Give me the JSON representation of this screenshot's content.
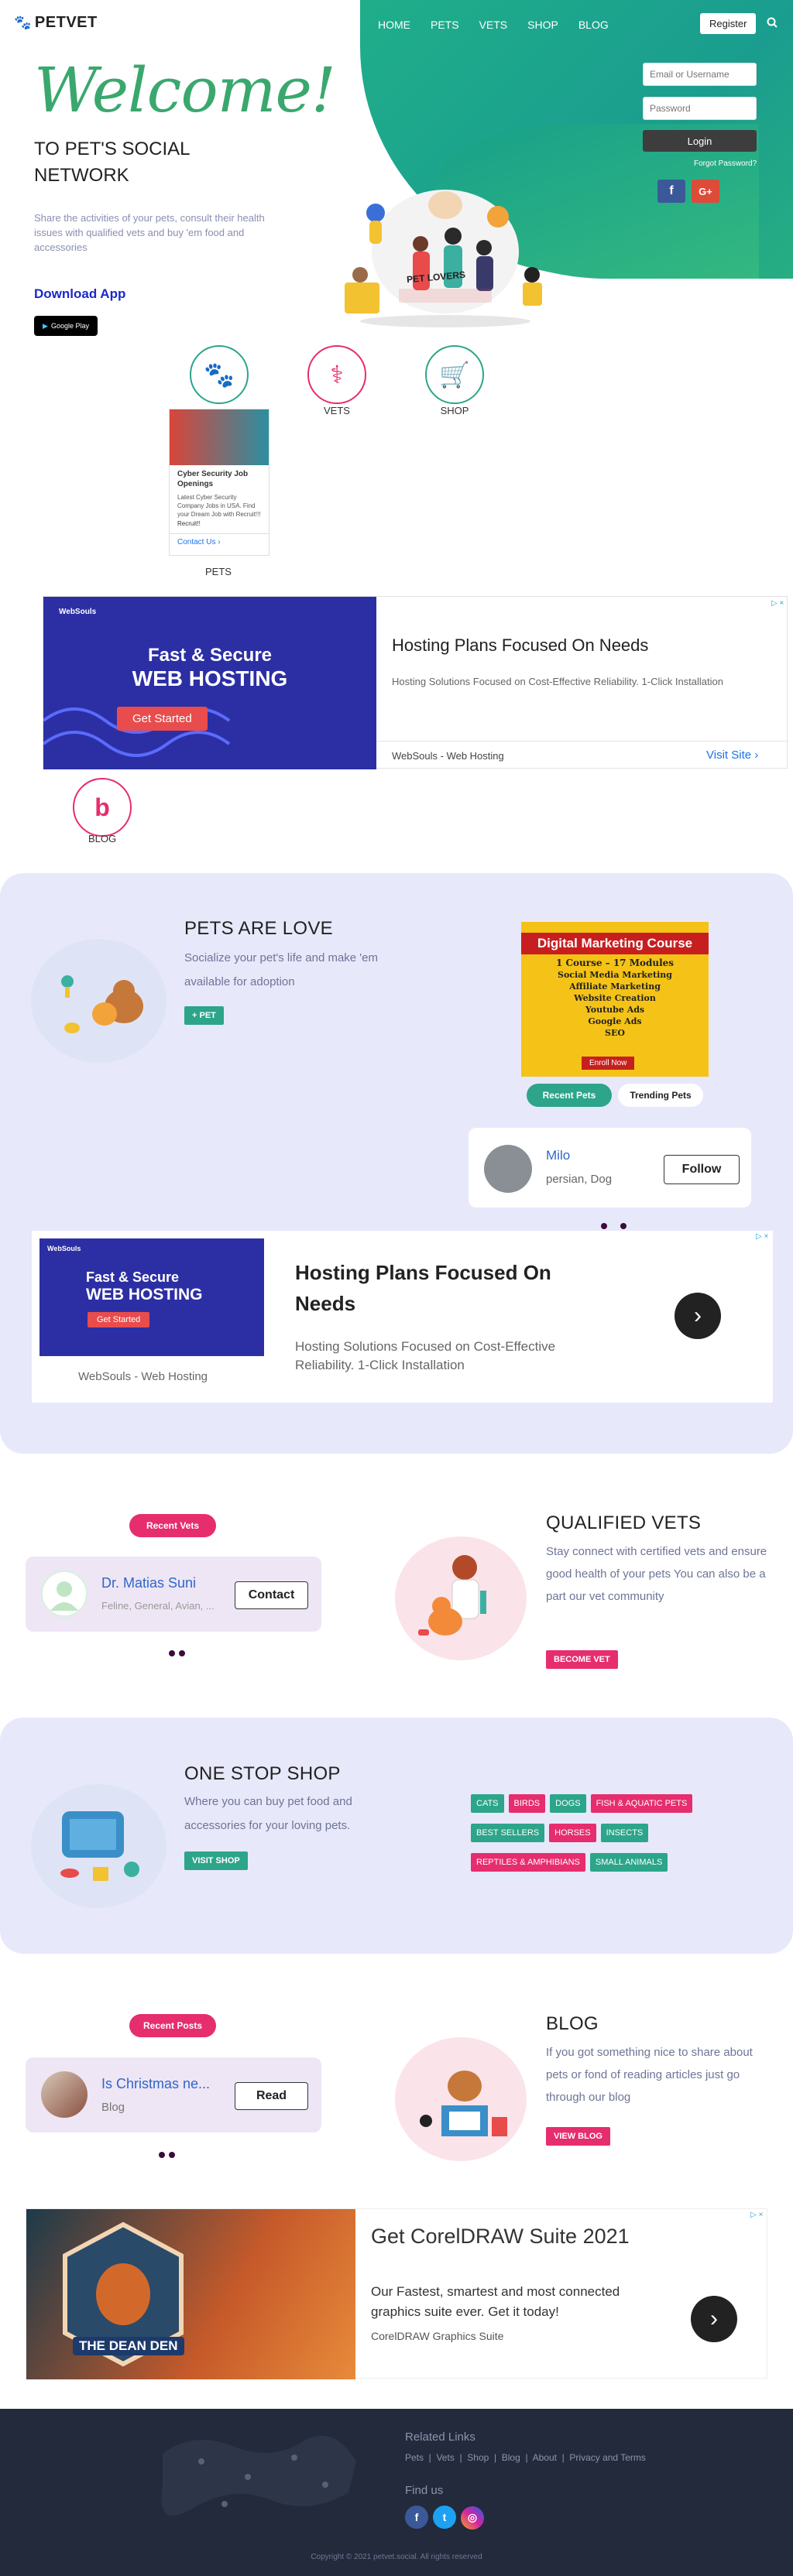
{
  "header": {
    "logo": "PETVET",
    "nav": [
      "HOME",
      "PETS",
      "VETS",
      "SHOP",
      "BLOG"
    ],
    "register": "Register"
  },
  "login": {
    "user_placeholder": "Email or Username",
    "pass_placeholder": "Password",
    "button": "Login",
    "forgot": "Forgot Password?",
    "fb": "f",
    "google": "G+"
  },
  "hero": {
    "welcome": "Welcome!",
    "subtitle": "TO PET'S SOCIAL NETWORK",
    "description": "Share the activities of your pets, consult their health issues with qualified vets and buy 'em food and accessories",
    "download": "Download App",
    "google_play": "Google Play",
    "illustration_label": "PET LOVERS"
  },
  "categories": {
    "pets": "PETS",
    "vets": "VETS",
    "shop": "SHOP",
    "blog": "BLOG"
  },
  "small_ad": {
    "title": "Cyber Security Job Openings",
    "body": "Latest Cyber Security Company Jobs in USA. Find your Dream Job with Recruit!!!",
    "brand": "Recruit!!",
    "cta": "Contact Us"
  },
  "ad1": {
    "logo": "WebSouls",
    "img_line1": "Fast & Secure",
    "img_line2": "WEB HOSTING",
    "img_btn": "Get Started",
    "title": "Hosting Plans Focused On Needs",
    "body": "Hosting Solutions Focused on Cost-Effective Reliability. 1-Click Installation",
    "brand": "WebSouls - Web Hosting",
    "cta": "Visit Site"
  },
  "pets_section": {
    "title": "PETS ARE LOVE",
    "description": "Socialize your pet's life and make 'em available for adoption",
    "button": "+ PET",
    "recent_tab": "Recent Pets",
    "trending_tab": "Trending Pets",
    "pet_name": "Milo",
    "pet_info": "persian, Dog",
    "follow": "Follow"
  },
  "dm_ad": {
    "badge": "Digital Marketing",
    "title": "Digital Marketing Course",
    "modules": "1 Course – 17 Modules",
    "items": [
      "Social Media Marketing",
      "Affiliate Marketing",
      "Website Creation",
      "Youtube Ads",
      "Google Ads",
      "SEO"
    ],
    "cta": "Enroll Now"
  },
  "ad2": {
    "logo": "WebSouls",
    "img_line1": "Fast & Secure",
    "img_line2": "WEB HOSTING",
    "img_btn": "Get Started",
    "title": "Hosting Plans Focused On Needs",
    "body": "Hosting Solutions Focused on Cost-Effective Reliability. 1-Click Installation",
    "brand": "WebSouls - Web Hosting"
  },
  "vets_section": {
    "recent_tab": "Recent Vets",
    "vet_name": "Dr. Matias Suni",
    "vet_info": "Feline, General, Avian, ...",
    "contact": "Contact",
    "title": "QUALIFIED VETS",
    "description": "Stay connect with certified vets and ensure good health of your pets You can also be a part our vet community",
    "button": "BECOME VET"
  },
  "shop_section": {
    "title": "ONE STOP SHOP",
    "description": "Where you can buy pet food and accessories for your loving pets.",
    "button": "VISIT SHOP",
    "tags": [
      "CATS",
      "BIRDS",
      "DOGS",
      "FISH & AQUATIC PETS",
      "BEST SELLERS",
      "HORSES",
      "INSECTS",
      "REPTILES & AMPHIBIANS",
      "SMALL ANIMALS"
    ]
  },
  "blog_section": {
    "recent_tab": "Recent Posts",
    "post_title": "Is Christmas ne...",
    "post_cat": "Blog",
    "read": "Read",
    "title": "BLOG",
    "description": "If you got something nice to share about pets or fond of reading articles just go through our blog",
    "button": "VIEW BLOG"
  },
  "ad3": {
    "img_text": "THE DEAN DEN",
    "title": "Get CorelDRAW Suite 2021",
    "body": "Our Fastest, smartest and most connected graphics suite ever. Get it today!",
    "brand": "CorelDRAW Graphics Suite"
  },
  "footer": {
    "related": "Related Links",
    "links": [
      "Pets",
      "Vets",
      "Shop",
      "Blog",
      "About",
      "Privacy and Terms"
    ],
    "find": "Find us",
    "copyright": "Copyright © 2021 petvet.social. All rights reserved"
  },
  "colors": {
    "green": "#2ca58a",
    "pink": "#e62d6d",
    "lavender": "#e8e8fb",
    "navy": "#232a3c"
  }
}
